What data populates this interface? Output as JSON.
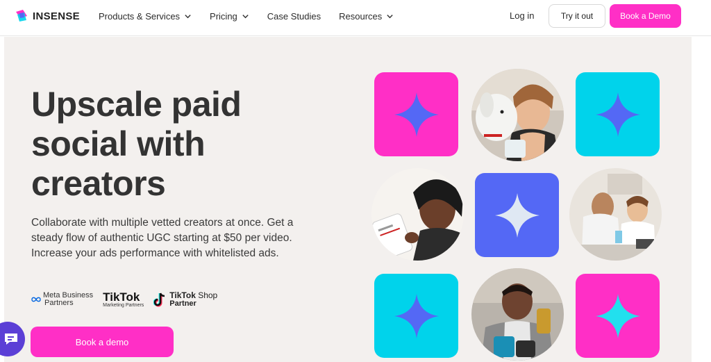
{
  "header": {
    "logo_text": "INSENSE",
    "nav": [
      {
        "label": "Products & Services",
        "has_dropdown": true
      },
      {
        "label": "Pricing",
        "has_dropdown": true
      },
      {
        "label": "Case Studies",
        "has_dropdown": false
      },
      {
        "label": "Resources",
        "has_dropdown": true
      }
    ],
    "login_label": "Log in",
    "try_label": "Try it out",
    "demo_label": "Book a Demo"
  },
  "hero": {
    "headline": "Upscale paid social with creators",
    "description": "Collaborate with multiple vetted creators at once. Get a steady flow of authentic UGC starting at $50 per video. Increase your ads performance with whitelisted ads.",
    "partners": {
      "meta_line1": "Meta Business",
      "meta_line2": "Partners",
      "tiktok_big": "TikTok",
      "tiktok_small": "Marketing Partners",
      "shop_line1_bold": "TikTok",
      "shop_line1_rest": " Shop",
      "shop_line2": "Partner"
    },
    "cta_label": "Book a demo"
  },
  "colors": {
    "accent_pink": "#ff2fc6",
    "cyan": "#00d3eb",
    "blue": "#5468f5",
    "chat_purple": "#5b3fd6",
    "hero_bg": "#f3f0ee"
  },
  "icons": [
    "logo-mark-icon",
    "chevron-down-icon",
    "sparkle-star-icon",
    "chat-icon",
    "meta-infinity-icon",
    "tiktok-note-icon"
  ]
}
